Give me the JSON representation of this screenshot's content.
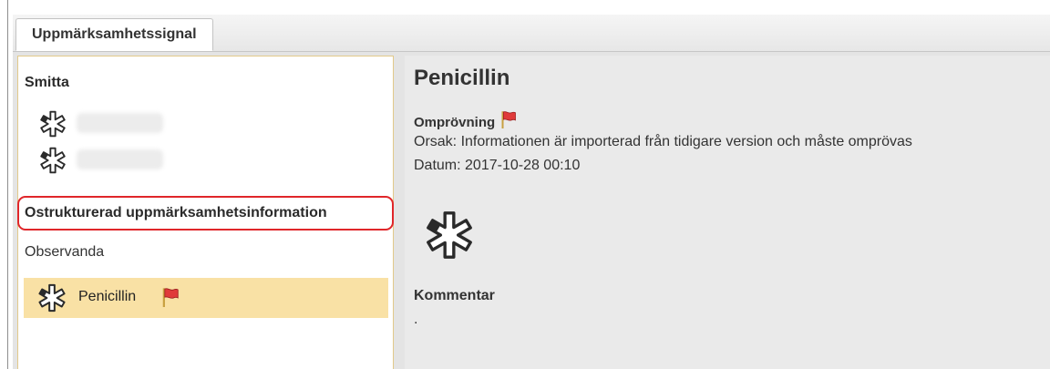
{
  "tab": {
    "label": "Uppmärksamhetssignal"
  },
  "left_panel": {
    "section_infection": "Smitta",
    "section_unstructured": "Ostrukturerad uppmärksamhetsinformation",
    "section_observed": "Observanda",
    "selected_item": {
      "label": "Penicillin",
      "icon": "asterisk-icon",
      "flag_icon": "flag-icon"
    }
  },
  "detail": {
    "title": "Penicillin",
    "review_label": "Omprövning",
    "reason": "Orsak: Informationen är importerad från tidigare version och måste omprövas",
    "date": "Datum: 2017-10-28 00:10",
    "comment_label": "Kommentar",
    "comment_value": "."
  },
  "colors": {
    "selected_row": "#f9e1a5",
    "highlight": "#e0262a",
    "panel_border": "#e2c98a",
    "flag": "#e03a3a"
  }
}
